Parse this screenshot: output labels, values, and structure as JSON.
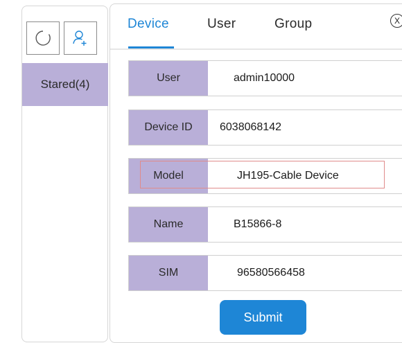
{
  "sidebar": {
    "refresh_icon": "refresh-icon",
    "add_user_icon": "add-user-icon",
    "stared_label": "Stared(4)"
  },
  "tabs": [
    {
      "label": "Device",
      "active": true
    },
    {
      "label": "User",
      "active": false
    },
    {
      "label": "Group",
      "active": false
    }
  ],
  "close_label": "X",
  "form": {
    "rows": [
      {
        "label": "User",
        "value": "admin10000"
      },
      {
        "label": "Device ID",
        "value": "6038068142"
      },
      {
        "label": "Model",
        "value": "JH195-Cable Device",
        "highlighted": true
      },
      {
        "label": "Name",
        "value": "B15866-8"
      },
      {
        "label": "SIM",
        "value": "96580566458"
      }
    ],
    "submit_label": "Submit"
  },
  "colors": {
    "accent": "#1e86d6",
    "label_bg": "#b9afd8",
    "highlight_border": "#e08b8b"
  }
}
